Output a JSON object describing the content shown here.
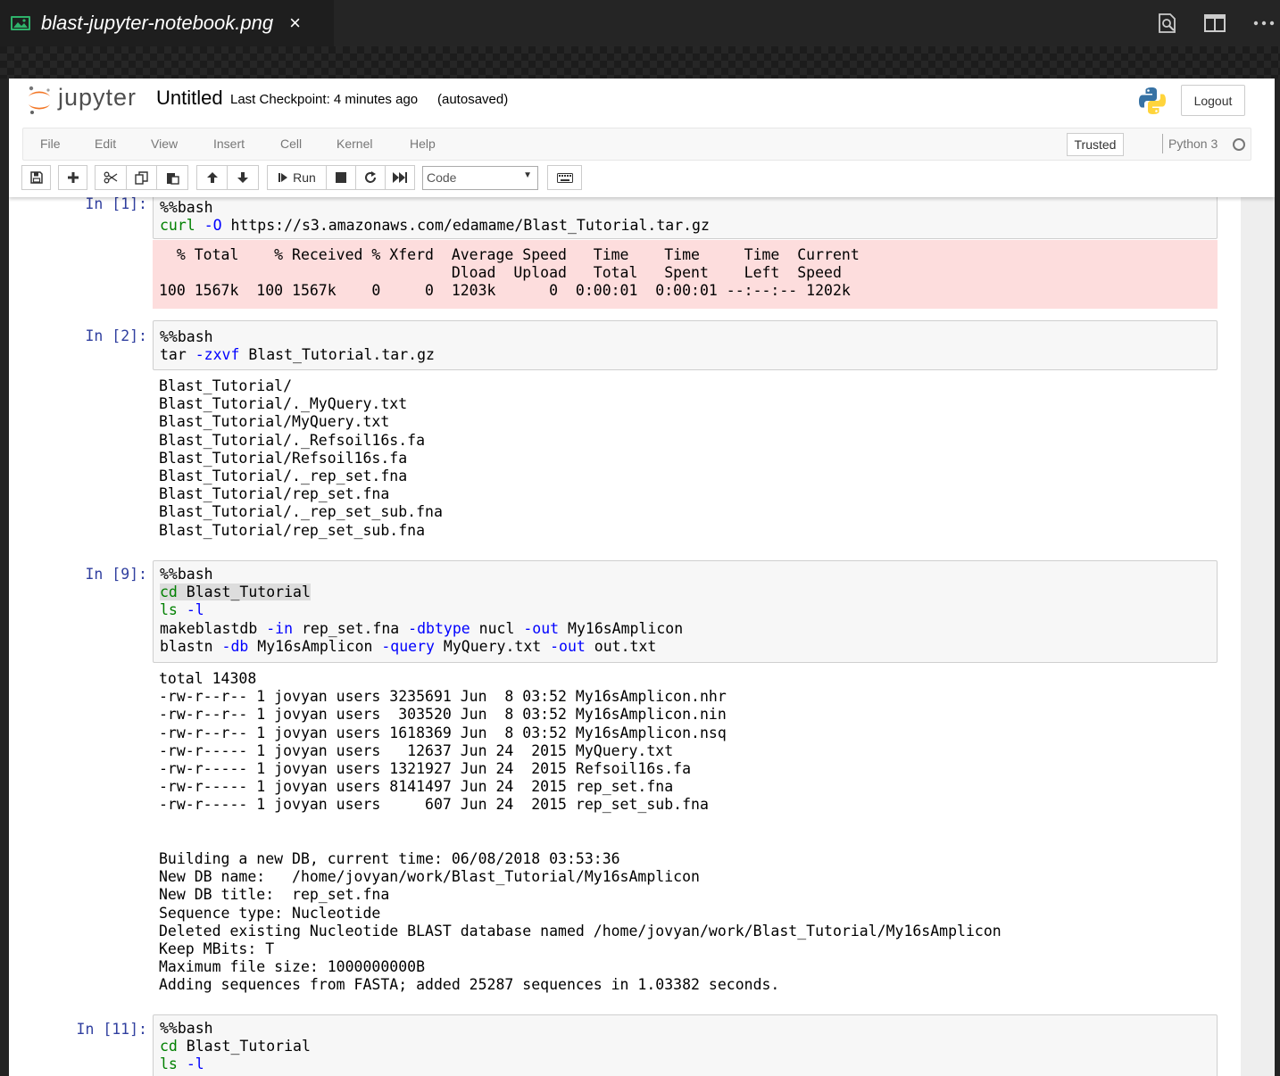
{
  "tab": {
    "title": "blast-jupyter-notebook.png",
    "close_glyph": "×",
    "icons": [
      "image-file-icon",
      "open-changes-icon",
      "split-editor-icon",
      "more-actions-icon"
    ]
  },
  "header": {
    "logo_text": "jupyter",
    "notebook_title": "Untitled",
    "checkpoint": "Last Checkpoint: 4 minutes ago",
    "autosaved": "(autosaved)",
    "logout_label": "Logout"
  },
  "menubar": {
    "items": [
      "File",
      "Edit",
      "View",
      "Insert",
      "Cell",
      "Kernel",
      "Help"
    ],
    "trusted_label": "Trusted",
    "kernel_name": "Python 3"
  },
  "toolbar": {
    "run_label": "Run",
    "cell_type": "Code"
  },
  "colors": {
    "prompt": "#303f9f",
    "stderr_background": "#fddddd",
    "keyword_green": "#008000",
    "option_blue": "#0000ff"
  },
  "cells": [
    {
      "prompt": "In [1]:",
      "input": [
        [
          {
            "t": "%%bash"
          }
        ],
        [
          {
            "t": "curl",
            "c": "kw"
          },
          {
            "t": " "
          },
          {
            "t": "-O",
            "c": "op"
          },
          {
            "t": " https://s3.amazonaws.com/edamame/Blast_Tutorial.tar.gz"
          }
        ]
      ],
      "stderr": [
        "  % Total    % Received % Xferd  Average Speed   Time    Time     Time  Current",
        "                                 Dload  Upload   Total   Spent    Left  Speed",
        "100 1567k  100 1567k    0     0  1203k      0  0:00:01  0:00:01 --:--:-- 1202k"
      ]
    },
    {
      "prompt": "In [2]:",
      "input": [
        [
          {
            "t": "%%bash"
          }
        ],
        [
          {
            "t": "tar "
          },
          {
            "t": "-zxvf",
            "c": "op"
          },
          {
            "t": " Blast_Tutorial.tar.gz"
          }
        ]
      ],
      "output": [
        "Blast_Tutorial/",
        "Blast_Tutorial/._MyQuery.txt",
        "Blast_Tutorial/MyQuery.txt",
        "Blast_Tutorial/._Refsoil16s.fa",
        "Blast_Tutorial/Refsoil16s.fa",
        "Blast_Tutorial/._rep_set.fna",
        "Blast_Tutorial/rep_set.fna",
        "Blast_Tutorial/._rep_set_sub.fna",
        "Blast_Tutorial/rep_set_sub.fna"
      ]
    },
    {
      "prompt": "In [9]:",
      "input": [
        [
          {
            "t": "%%bash"
          }
        ],
        [
          {
            "t": "cd",
            "c": "kw sel"
          },
          {
            "t": " Blast_Tutorial",
            "c": "sel"
          }
        ],
        [
          {
            "t": "ls",
            "c": "kw"
          },
          {
            "t": " "
          },
          {
            "t": "-l",
            "c": "op"
          }
        ],
        [
          {
            "t": "makeblastdb "
          },
          {
            "t": "-in",
            "c": "op"
          },
          {
            "t": " rep_set.fna "
          },
          {
            "t": "-dbtype",
            "c": "op"
          },
          {
            "t": " nucl "
          },
          {
            "t": "-out",
            "c": "op"
          },
          {
            "t": " My16sAmplicon"
          }
        ],
        [
          {
            "t": "blastn "
          },
          {
            "t": "-db",
            "c": "op"
          },
          {
            "t": " My16sAmplicon "
          },
          {
            "t": "-query",
            "c": "op"
          },
          {
            "t": " MyQuery.txt "
          },
          {
            "t": "-out",
            "c": "op"
          },
          {
            "t": " out.txt"
          }
        ]
      ],
      "output": [
        "total 14308",
        "-rw-r--r-- 1 jovyan users 3235691 Jun  8 03:52 My16sAmplicon.nhr",
        "-rw-r--r-- 1 jovyan users  303520 Jun  8 03:52 My16sAmplicon.nin",
        "-rw-r--r-- 1 jovyan users 1618369 Jun  8 03:52 My16sAmplicon.nsq",
        "-rw-r----- 1 jovyan users   12637 Jun 24  2015 MyQuery.txt",
        "-rw-r----- 1 jovyan users 1321927 Jun 24  2015 Refsoil16s.fa",
        "-rw-r----- 1 jovyan users 8141497 Jun 24  2015 rep_set.fna",
        "-rw-r----- 1 jovyan users     607 Jun 24  2015 rep_set_sub.fna",
        "",
        "",
        "Building a new DB, current time: 06/08/2018 03:53:36",
        "New DB name:   /home/jovyan/work/Blast_Tutorial/My16sAmplicon",
        "New DB title:  rep_set.fna",
        "Sequence type: Nucleotide",
        "Deleted existing Nucleotide BLAST database named /home/jovyan/work/Blast_Tutorial/My16sAmplicon",
        "Keep MBits: T",
        "Maximum file size: 1000000000B",
        "Adding sequences from FASTA; added 25287 sequences in 1.03382 seconds."
      ]
    },
    {
      "prompt": "In [11]:",
      "input": [
        [
          {
            "t": "%%bash"
          }
        ],
        [
          {
            "t": "cd",
            "c": "kw"
          },
          {
            "t": " Blast_Tutorial"
          }
        ],
        [
          {
            "t": "ls",
            "c": "kw"
          },
          {
            "t": " "
          },
          {
            "t": "-l",
            "c": "op"
          }
        ]
      ]
    }
  ]
}
